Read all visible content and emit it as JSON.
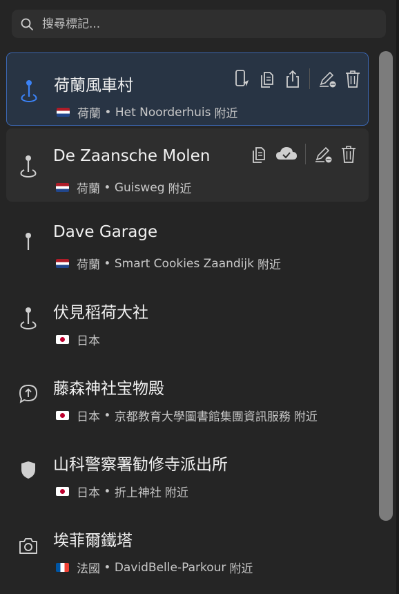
{
  "search": {
    "placeholder": "搜尋標記..."
  },
  "items": [
    {
      "title": "荷蘭風車村",
      "flag": "nl",
      "country": "荷蘭",
      "place": "Het Noorderhuis",
      "suffix": "附近",
      "icon": "pin-icon",
      "state": "selected"
    },
    {
      "title": "De Zaansche Molen",
      "flag": "nl",
      "country": "荷蘭",
      "place": "Guisweg",
      "suffix": "附近",
      "icon": "pin-icon",
      "state": "hover"
    },
    {
      "title": "Dave Garage",
      "flag": "nl",
      "country": "荷蘭",
      "place": "Smart Cookies Zaandijk",
      "suffix": "附近",
      "icon": "pushpin-icon",
      "state": "normal"
    },
    {
      "title": "伏見稻荷大社",
      "flag": "jp",
      "country": "日本",
      "place": "",
      "suffix": "",
      "icon": "pin-icon",
      "state": "normal"
    },
    {
      "title": "藤森神社宝物殿",
      "flag": "jp",
      "country": "日本",
      "place": "京都教育大學圖書館集團資訊服務",
      "suffix": "附近",
      "icon": "upload-bubble-icon",
      "state": "normal"
    },
    {
      "title": "山科警察署勧修寺派出所",
      "flag": "jp",
      "country": "日本",
      "place": "折上神社",
      "suffix": "附近",
      "icon": "shield-icon",
      "state": "normal"
    },
    {
      "title": "埃菲爾鐵塔",
      "flag": "fr",
      "country": "法國",
      "place": "DavidBelle-Parkour",
      "suffix": "附近",
      "icon": "camera-icon",
      "state": "normal"
    }
  ],
  "colors": {
    "accent": "#3b67b3",
    "selected_bg": "#283444",
    "background": "#252525"
  },
  "actions_selected": [
    "send-to-device-icon",
    "copy-icon",
    "share-icon",
    "edit-icon",
    "delete-icon"
  ],
  "actions_hover": [
    "copy-icon",
    "cloud-icon",
    "edit-icon",
    "delete-icon"
  ]
}
